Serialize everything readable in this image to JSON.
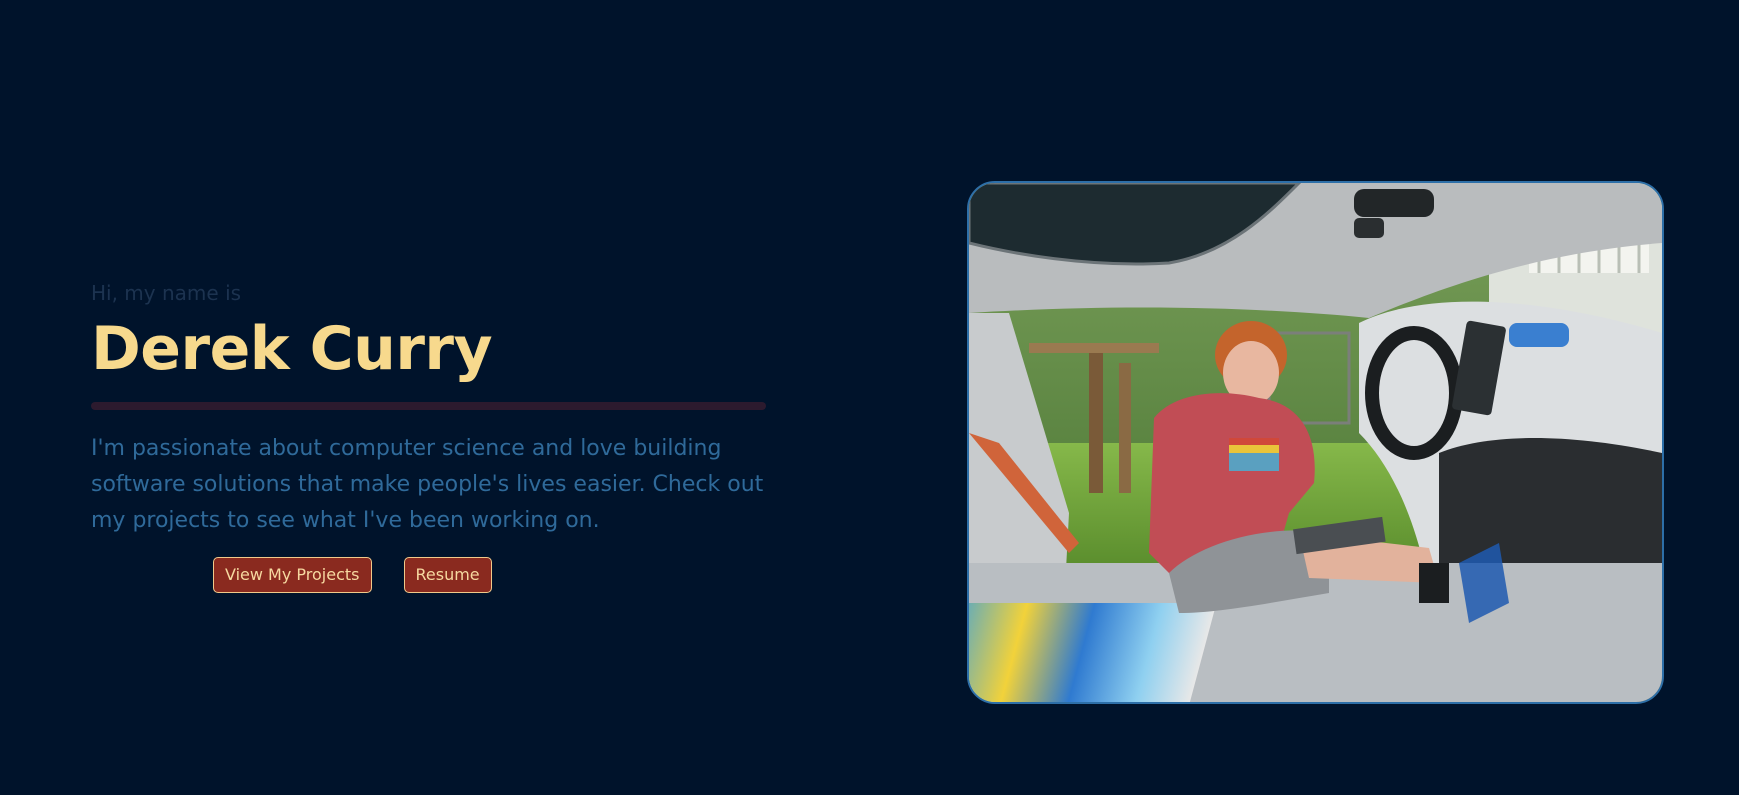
{
  "hero": {
    "greeting": "Hi, my name is",
    "name": "Derek Curry",
    "bio": "I'm passionate about computer science and love building software solutions that make people's lives easier. Check out my projects to see what I've been working on.",
    "buttons": {
      "projects_label": "View My Projects",
      "resume_label": "Resume"
    }
  },
  "colors": {
    "background": "#00132b",
    "name": "#f7d98d",
    "bio": "#2f6a9a",
    "greeting": "#1c3350",
    "button_bg": "#8a2a1f",
    "button_border": "#f1c98a",
    "photo_border": "#2d6fa8"
  }
}
